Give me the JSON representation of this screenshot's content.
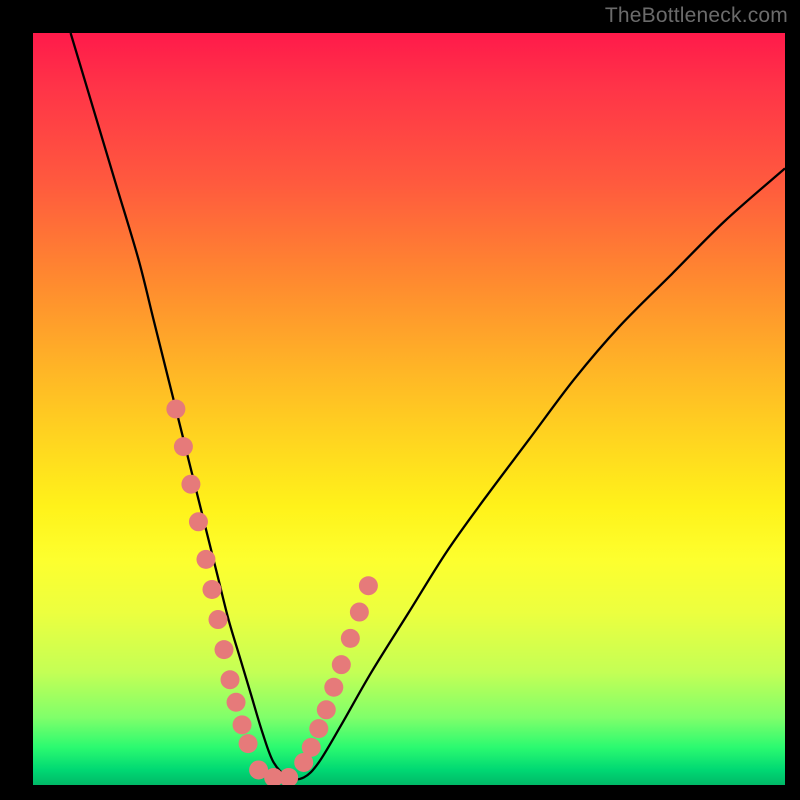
{
  "watermark": "TheBottleneck.com",
  "chart_data": {
    "type": "line",
    "title": "",
    "xlabel": "",
    "ylabel": "",
    "xlim": [
      0,
      100
    ],
    "ylim": [
      0,
      100
    ],
    "series": [
      {
        "name": "bottleneck-curve",
        "x": [
          5,
          8,
          11,
          14,
          16,
          18,
          20,
          21.5,
          23,
          24.5,
          26,
          27.5,
          29,
          30.5,
          32,
          34,
          36,
          38,
          41,
          45,
          50,
          55,
          60,
          66,
          72,
          78,
          85,
          92,
          100
        ],
        "values": [
          100,
          90,
          80,
          70,
          62,
          54,
          46,
          40,
          34,
          28,
          22,
          17,
          12,
          7,
          3,
          1,
          1,
          3,
          8,
          15,
          23,
          31,
          38,
          46,
          54,
          61,
          68,
          75,
          82
        ]
      }
    ],
    "marker_points": {
      "name": "highlight-dots",
      "x": [
        19,
        20,
        21,
        22,
        23,
        23.8,
        24.6,
        25.4,
        26.2,
        27,
        27.8,
        28.6,
        30,
        32,
        34,
        36,
        37,
        38,
        39,
        40,
        41,
        42.2,
        43.4,
        44.6
      ],
      "values": [
        50,
        45,
        40,
        35,
        30,
        26,
        22,
        18,
        14,
        11,
        8,
        5.5,
        2,
        1,
        1,
        3,
        5,
        7.5,
        10,
        13,
        16,
        19.5,
        23,
        26.5
      ]
    },
    "colors": {
      "curve": "#000000",
      "dots": "#e67a7a",
      "gradient_top": "#ff1a4a",
      "gradient_bottom": "#00b867"
    }
  }
}
